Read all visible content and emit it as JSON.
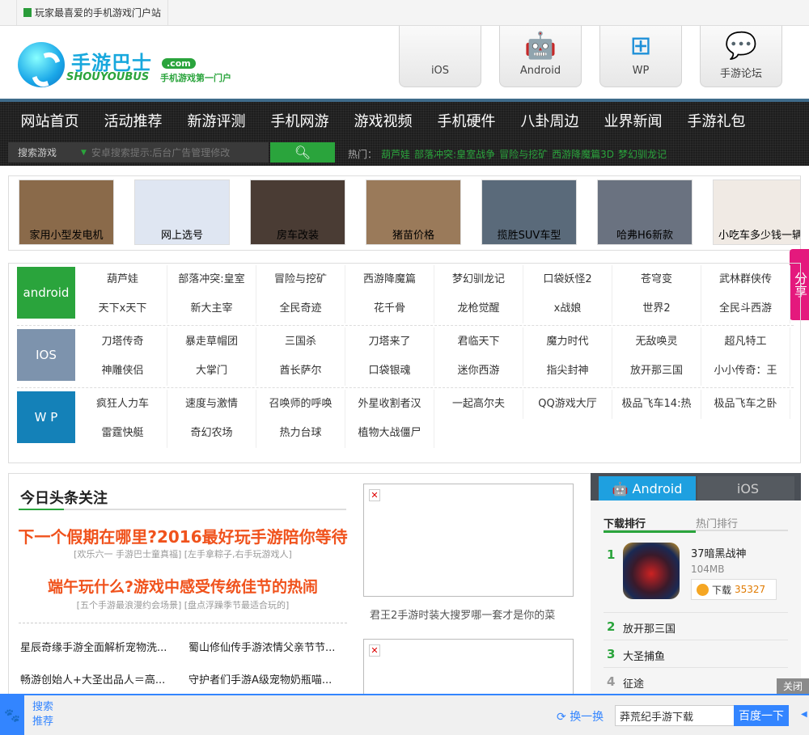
{
  "topbar": {
    "tab_title": "玩家最喜爱的手机游戏门户站"
  },
  "logo": {
    "cn": "手游巴士",
    "com": ".com",
    "en": "SHOUYOUBUS",
    "slogan": "手机游戏第一门户"
  },
  "platforms": [
    {
      "label": "iOS",
      "icon": ""
    },
    {
      "label": "Android",
      "icon": "🤖"
    },
    {
      "label": "WP",
      "icon": "⊞"
    },
    {
      "label": "手游论坛",
      "icon": "💬"
    }
  ],
  "nav": {
    "items": [
      "网站首页",
      "活动推荐",
      "新游评测",
      "手机网游",
      "游戏视频",
      "手机硬件",
      "八卦周边",
      "业界新闻",
      "手游礼包"
    ]
  },
  "search": {
    "category": "搜索游戏",
    "placeholder": "安卓搜索提示:后台广告管理修改",
    "hot_label": "热门：",
    "hot": [
      "葫芦娃",
      "部落冲突:皇室战争",
      "冒险与挖矿",
      "西游降魔篇3D",
      "梦幻驯龙记"
    ]
  },
  "ads": [
    {
      "label": "家用小型发电机",
      "color": "#8a6a4a"
    },
    {
      "label": "网上选号",
      "color": "#dfe6f2"
    },
    {
      "label": "房车改装",
      "color": "#4a3c34"
    },
    {
      "label": "猪苗价格",
      "color": "#9a7a5a"
    },
    {
      "label": "揽胜SUV车型",
      "color": "#5a6a7a"
    },
    {
      "label": "哈弗H6新款",
      "color": "#6a7280"
    },
    {
      "label": "小吃车多少钱一辆",
      "color": "#f0eae4"
    }
  ],
  "share": "分享",
  "categories": [
    {
      "label": "android",
      "color": "#2aa43c",
      "games": [
        "葫芦娃",
        "部落冲突:皇室",
        "冒险与挖矿",
        "西游降魔篇",
        "梦幻驯龙记",
        "口袋妖怪2",
        "苍穹变",
        "武林群侠传",
        "天下x天下",
        "新大主宰",
        "全民奇迹",
        "花千骨",
        "龙枪觉醒",
        "x战娘",
        "世界2",
        "全民斗西游"
      ]
    },
    {
      "label": "IOS",
      "color": "#7d93ad",
      "games": [
        "刀塔传奇",
        "暴走草帽团",
        "三国杀",
        "刀塔来了",
        "君临天下",
        "魔力时代",
        "无敌唤灵",
        "超凡特工",
        "神雕侠侣",
        "大掌门",
        "酋长萨尔",
        "口袋银魂",
        "迷你西游",
        "指尖封神",
        "放开那三国",
        "小小传奇：王"
      ]
    },
    {
      "label": "W P",
      "color": "#1481b8",
      "games": [
        "疯狂人力车",
        "速度与激情",
        "召唤师的呼唤",
        "外星收割者汉",
        "一起高尔夫",
        "QQ游戏大厅",
        "极品飞车14:热",
        "极品飞车之卧",
        "雷霆快艇",
        "奇幻农场",
        "热力台球",
        "植物大战僵尸"
      ]
    }
  ],
  "headlines": {
    "title": "今日头条关注",
    "items": [
      {
        "title": "下一个假期在哪里?2016最好玩手游陪你等待",
        "sub": "[欢乐六一 手游巴士童真福] [左手拿粽子,右手玩游戏人]"
      },
      {
        "title": "端午玩什么?游戏中感受传统佳节的热闹",
        "sub": "[五个手游最浪漫约会场景] [盘点浮躁季节最适合玩的]"
      }
    ],
    "news": [
      "星辰奇缘手游全面解析宠物洗...",
      "蜀山修仙传手游浓情父亲节节...",
      "畅游创始人+大圣出品人＝高...",
      "守护者们手游A级宠物奶瓶喵..."
    ]
  },
  "image_caption": "君王2手游时装大搜罗哪一套才是你的菜",
  "sidebar": {
    "tabs": [
      "Android",
      "iOS"
    ],
    "subtabs": [
      "下载排行",
      "热门排行"
    ],
    "top": {
      "rank": "1",
      "name": "37暗黑战神",
      "size": "104MB",
      "download_label": "下载",
      "downloads": "35327"
    },
    "ranks": [
      {
        "rank": "2",
        "name": "放开那三国"
      },
      {
        "rank": "3",
        "name": "大圣捕鱼"
      },
      {
        "rank": "4",
        "name": "征途"
      }
    ]
  },
  "close": "关闭",
  "bottom": {
    "search": "搜索",
    "recommend": "推荐",
    "swap": "换一换",
    "query": "莽荒纪手游下载",
    "button": "百度一下"
  }
}
